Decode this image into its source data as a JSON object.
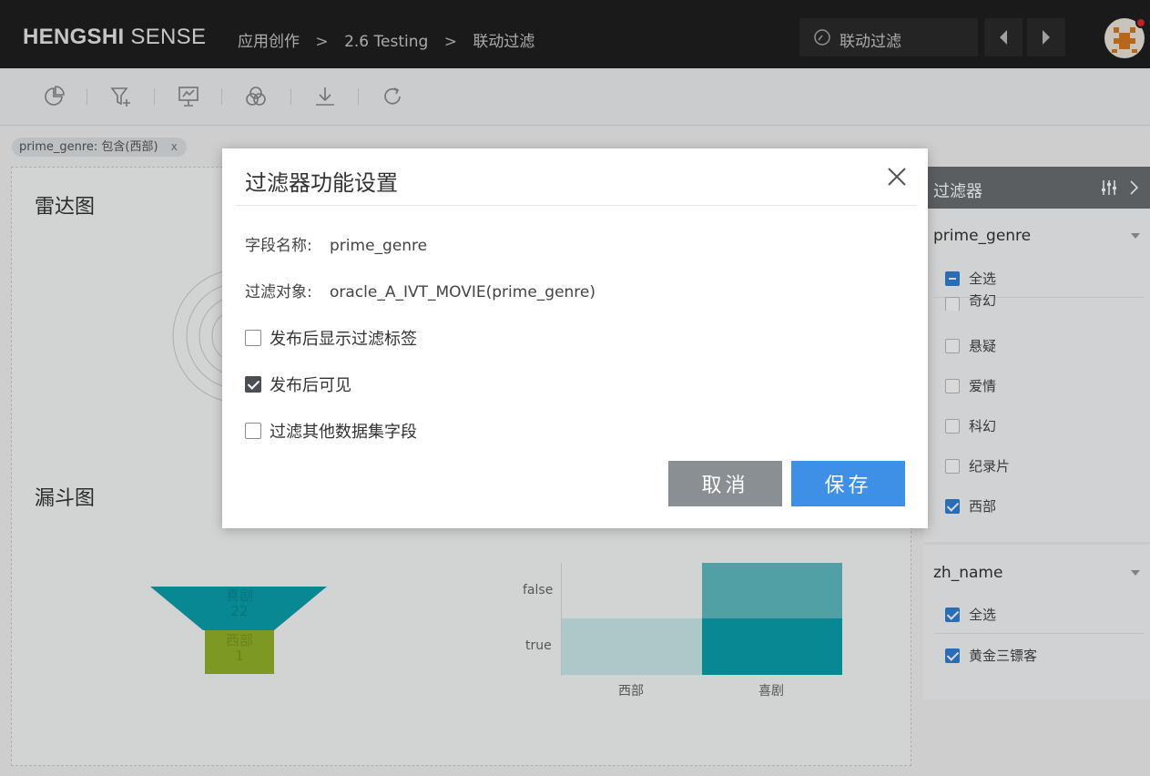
{
  "header": {
    "logo_bold": "HENGSHI",
    "logo_light": "SENSE",
    "breadcrumb": [
      "应用创作",
      "2.6 Testing",
      "联动过滤"
    ],
    "breadcrumb_sep": ">",
    "dashboard_selector": "联动过滤"
  },
  "toolbar": {
    "tools": [
      "chart-add-icon",
      "filter-add-icon",
      "presentation-icon",
      "venn-icon",
      "download-icon",
      "refresh-icon"
    ]
  },
  "filter_tag": {
    "label": "prime_genre: 包含(西部)",
    "close": "x"
  },
  "canvas": {
    "radar_title": "雷达图",
    "funnel_title": "漏斗图",
    "funnel": {
      "top_label": "喜剧",
      "top_value": "22",
      "bottom_label": "西部",
      "bottom_value": "1"
    },
    "heatmap": {
      "y_labels": [
        "false",
        "true"
      ],
      "x_labels": [
        "西部",
        "喜剧"
      ]
    }
  },
  "right_panel": {
    "title": "过滤器",
    "section1": {
      "field": "prime_genre",
      "items": [
        {
          "label": "全选",
          "state": "partial"
        },
        {
          "label": "奇幻",
          "state": "unchecked"
        },
        {
          "label": "悬疑",
          "state": "unchecked"
        },
        {
          "label": "爱情",
          "state": "unchecked"
        },
        {
          "label": "科幻",
          "state": "unchecked"
        },
        {
          "label": "纪录片",
          "state": "unchecked"
        },
        {
          "label": "西部",
          "state": "checked"
        }
      ]
    },
    "section2": {
      "field": "zh_name",
      "items": [
        {
          "label": "全选",
          "state": "checked"
        },
        {
          "label": "黄金三镖客",
          "state": "checked"
        }
      ]
    }
  },
  "modal": {
    "title": "过滤器功能设置",
    "field_name_label": "字段名称:",
    "field_name_value": "prime_genre",
    "filter_target_label": "过滤对象:",
    "filter_target_value": "oracle_A_IVT_MOVIE(prime_genre)",
    "options": [
      {
        "label": "发布后显示过滤标签",
        "checked": false
      },
      {
        "label": "发布后可见",
        "checked": true
      },
      {
        "label": "过滤其他数据集字段",
        "checked": false
      }
    ],
    "cancel_label": "取消",
    "save_label": "保存"
  },
  "colors": {
    "topbar": "#1f1f1f",
    "primary_button": "#3e8fe6",
    "cancel_button": "#8a8f94",
    "teal": "#0aa0ac",
    "olive": "#93b42a"
  }
}
